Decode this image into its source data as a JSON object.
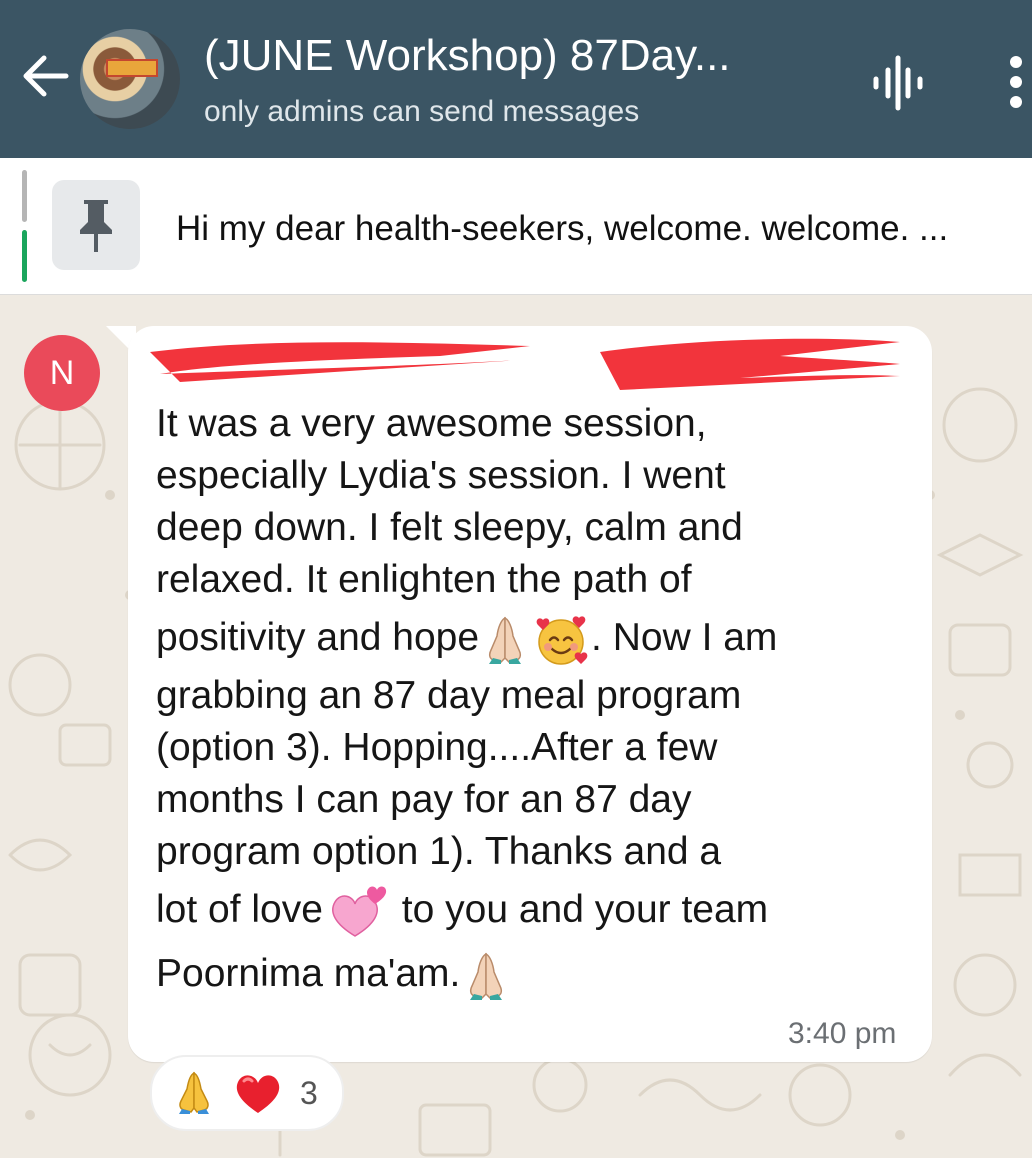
{
  "header": {
    "title": "(JUNE Workshop)  87Day...",
    "subtitle": "only admins can send messages",
    "back_icon": "arrow-left-icon",
    "voice_icon": "voice-chat-icon",
    "menu_icon": "more-vertical-icon",
    "background_color": "#3b5564"
  },
  "pinned": {
    "icon": "pin-icon",
    "text": "Hi my dear health-seekers, welcome. welcome. ..."
  },
  "message": {
    "sender_initial": "N",
    "sender_avatar_color": "#ea4a5a",
    "sender_name_redacted": true,
    "lines": [
      "It was a very awesome session,",
      "especially Lydia's session. I went",
      "deep down. I felt sleepy, calm and",
      "relaxed. It enlighten the path of",
      "positivity and hope",
      ". Now I am",
      "grabbing an 87 day meal program",
      "(option 3). Hopping....After a few",
      "months I can pay for an 87 day",
      "program option 1). Thanks and a",
      "lot of love",
      " to you and your team",
      "Poornima ma'am."
    ],
    "time": "3:40 pm"
  },
  "reactions": {
    "emojis": [
      "folded-hands-emoji",
      "red-heart-emoji"
    ],
    "count": "3"
  }
}
